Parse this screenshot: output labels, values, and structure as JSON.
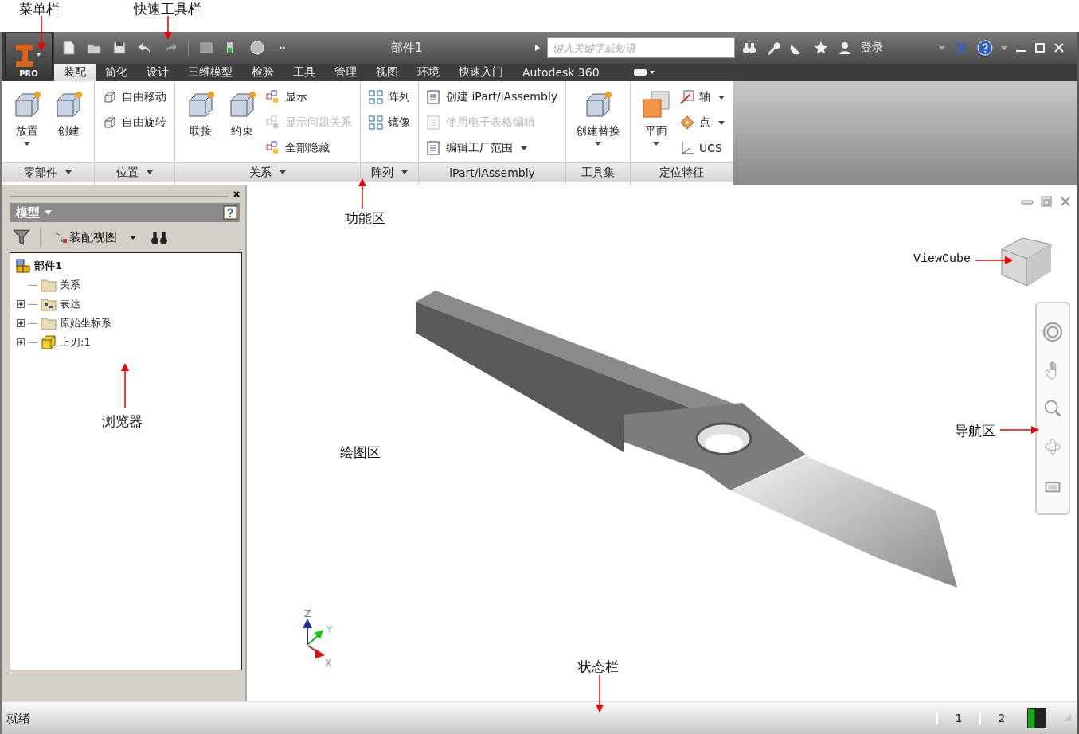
{
  "annotations": [
    {
      "label": "菜单栏"
    },
    {
      "label": "快速工具栏"
    },
    {
      "label": "功能区"
    },
    {
      "label": "浏览器"
    },
    {
      "label": "绘图区"
    },
    {
      "label": "ViewCube"
    },
    {
      "label": "导航区"
    },
    {
      "label": "状态栏"
    }
  ],
  "app_button": {
    "badge": "PRO"
  },
  "title_bar": {
    "document": "部件1",
    "search": {
      "placeholder": "键入关键字或短语"
    },
    "sign_in": "登录"
  },
  "tabs": [
    {
      "label": "装配",
      "selected": true
    },
    {
      "label": "简化",
      "selected": false
    },
    {
      "label": "设计",
      "selected": false
    },
    {
      "label": "三维模型",
      "selected": false
    },
    {
      "label": "检验",
      "selected": false
    },
    {
      "label": "工具",
      "selected": false
    },
    {
      "label": "管理",
      "selected": false
    },
    {
      "label": "视图",
      "selected": false
    },
    {
      "label": "环境",
      "selected": false
    },
    {
      "label": "快速入门",
      "selected": false
    },
    {
      "label": "Autodesk 360",
      "selected": false
    }
  ],
  "ribbon": {
    "panels": [
      {
        "title": "零部件",
        "has_menu": true,
        "items": [
          {
            "kind": "large",
            "label": "放置",
            "dropdown": true,
            "disabled": false
          },
          {
            "kind": "large",
            "label": "创建",
            "dropdown": false,
            "disabled": false
          }
        ]
      },
      {
        "title": "位置",
        "has_menu": true,
        "items": [
          {
            "kind": "small",
            "label": "自由移动",
            "dropdown": false,
            "disabled": false
          },
          {
            "kind": "small",
            "label": "自由旋转",
            "dropdown": false,
            "disabled": false
          }
        ]
      },
      {
        "title": "关系",
        "has_menu": true,
        "items": [
          {
            "kind": "large",
            "label": "联接",
            "dropdown": false,
            "disabled": false
          },
          {
            "kind": "large",
            "label": "约束",
            "dropdown": false,
            "disabled": false
          },
          {
            "kind": "small",
            "label": "显示",
            "dropdown": false,
            "disabled": false
          },
          {
            "kind": "small",
            "label": "显示问题关系",
            "dropdown": false,
            "disabled": true
          },
          {
            "kind": "small",
            "label": "全部隐藏",
            "dropdown": false,
            "disabled": false
          }
        ]
      },
      {
        "title": "阵列",
        "has_menu": true,
        "items": [
          {
            "kind": "small",
            "label": "阵列",
            "dropdown": false,
            "disabled": false
          },
          {
            "kind": "small",
            "label": "镜像",
            "dropdown": false,
            "disabled": false
          }
        ]
      },
      {
        "title": "iPart/iAssembly",
        "has_menu": false,
        "items": [
          {
            "kind": "small",
            "label": "创建 iPart/iAssembly",
            "dropdown": false,
            "disabled": false
          },
          {
            "kind": "small",
            "label": "使用电子表格编辑",
            "dropdown": false,
            "disabled": true
          },
          {
            "kind": "small",
            "label": "编辑工厂范围",
            "dropdown": true,
            "disabled": false
          }
        ]
      },
      {
        "title": "工具集",
        "has_menu": false,
        "items": [
          {
            "kind": "large",
            "label": "创建替换",
            "dropdown": true,
            "disabled": false
          }
        ]
      },
      {
        "title": "定位特征",
        "has_menu": false,
        "items": [
          {
            "kind": "large",
            "label": "平面",
            "dropdown": true,
            "disabled": false
          },
          {
            "kind": "small",
            "label": "轴",
            "dropdown": true,
            "disabled": false
          },
          {
            "kind": "small",
            "label": "点",
            "dropdown": true,
            "disabled": false
          },
          {
            "kind": "small",
            "label": "UCS",
            "dropdown": false,
            "disabled": false
          }
        ]
      }
    ]
  },
  "browser": {
    "title": "模型",
    "view": "装配视图",
    "tree": {
      "label": "部件1",
      "kind": "assembly",
      "children": [
        {
          "label": "关系",
          "kind": "folder",
          "expandable": false
        },
        {
          "label": "表达",
          "kind": "views",
          "expandable": true,
          "expanded": false
        },
        {
          "label": "原始坐标系",
          "kind": "folder",
          "expandable": true,
          "expanded": false
        },
        {
          "label": "上刃:1",
          "kind": "part",
          "expandable": true,
          "expanded": false
        }
      ]
    }
  },
  "canvas": {
    "triad": [
      "Z",
      "Y",
      "X"
    ]
  },
  "status_bar": {
    "message": "就绪",
    "cells": [
      "1",
      "2"
    ]
  }
}
